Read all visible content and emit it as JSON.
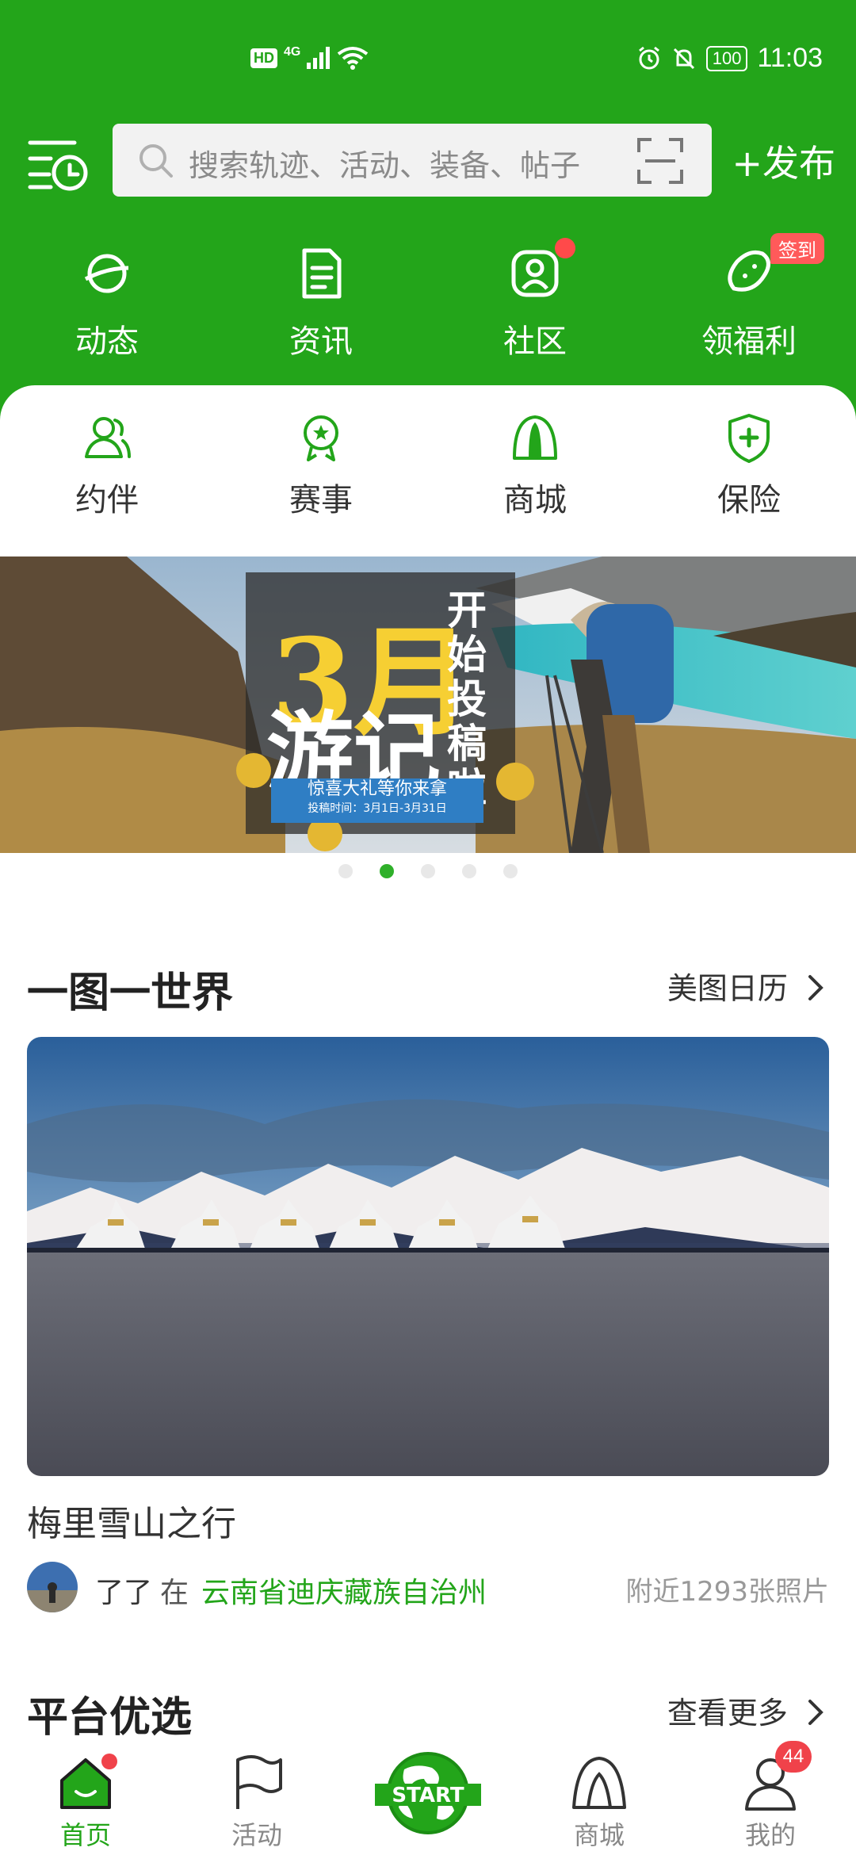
{
  "status_bar": {
    "network": "4G",
    "hd": "HD",
    "battery": "100",
    "time": "11:03"
  },
  "header": {
    "search_placeholder": "搜索轨迹、活动、装备、帖子",
    "publish_label": "+发布"
  },
  "top_nav": [
    {
      "label": "动态",
      "icon": "planet-icon"
    },
    {
      "label": "资讯",
      "icon": "document-icon"
    },
    {
      "label": "社区",
      "icon": "community-icon"
    },
    {
      "label": "领福利",
      "icon": "bean-icon",
      "badge": "签到"
    }
  ],
  "sub_nav": [
    {
      "label": "约伴",
      "icon": "partners-icon"
    },
    {
      "label": "赛事",
      "icon": "medal-icon"
    },
    {
      "label": "商城",
      "icon": "tent-icon"
    },
    {
      "label": "保险",
      "icon": "shield-icon"
    }
  ],
  "banner": {
    "headline_1": "3月",
    "headline_2": "游记",
    "vertical_text": "开始投稿啦",
    "ribbon_text": "惊喜大礼等你来拿",
    "ribbon_sub": "投稿时间：3月1日-3月31日",
    "dot_count": 5,
    "active_dot": 2
  },
  "section_world": {
    "title": "一图一世界",
    "more_label": "美图日历",
    "photo_title": "梅里雪山之行",
    "user": "了了",
    "at": "在",
    "location": "云南省迪庆藏族自治州",
    "photo_count": "附近1293张照片"
  },
  "section_platform": {
    "title": "平台优选",
    "more_label": "查看更多"
  },
  "bottom_nav": [
    {
      "label": "首页",
      "active": true
    },
    {
      "label": "活动",
      "active": false
    },
    {
      "label": "START",
      "active": false
    },
    {
      "label": "商城",
      "active": false
    },
    {
      "label": "我的",
      "active": false,
      "badge": "44"
    }
  ],
  "colors": {
    "brand_green": "#23a51a",
    "badge_red": "#f0424a"
  }
}
